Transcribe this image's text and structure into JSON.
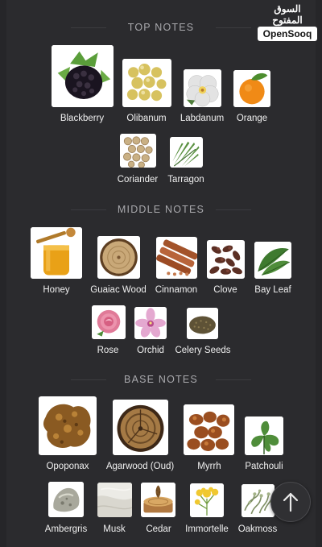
{
  "brand": {
    "arabic": "السوق المفتوح",
    "english": "OpenSooq"
  },
  "sections": [
    {
      "title": "TOP NOTES",
      "notes": [
        {
          "label": "Blackberry",
          "icon": "blackberry-icon"
        },
        {
          "label": "Olibanum",
          "icon": "olibanum-icon"
        },
        {
          "label": "Labdanum",
          "icon": "labdanum-icon"
        },
        {
          "label": "Orange",
          "icon": "orange-icon"
        },
        {
          "label": "Coriander",
          "icon": "coriander-icon"
        },
        {
          "label": "Tarragon",
          "icon": "tarragon-icon"
        }
      ]
    },
    {
      "title": "MIDDLE NOTES",
      "notes": [
        {
          "label": "Honey",
          "icon": "honey-icon"
        },
        {
          "label": "Guaiac Wood",
          "icon": "guaiac-wood-icon"
        },
        {
          "label": "Cinnamon",
          "icon": "cinnamon-icon"
        },
        {
          "label": "Clove",
          "icon": "clove-icon"
        },
        {
          "label": "Bay Leaf",
          "icon": "bay-leaf-icon"
        },
        {
          "label": "Rose",
          "icon": "rose-icon"
        },
        {
          "label": "Orchid",
          "icon": "orchid-icon"
        },
        {
          "label": "Celery Seeds",
          "icon": "celery-seeds-icon"
        }
      ]
    },
    {
      "title": "BASE NOTES",
      "notes": [
        {
          "label": "Opoponax",
          "icon": "opoponax-icon"
        },
        {
          "label": "Agarwood (Oud)",
          "icon": "agarwood-icon"
        },
        {
          "label": "Myrrh",
          "icon": "myrrh-icon"
        },
        {
          "label": "Patchouli",
          "icon": "patchouli-icon"
        },
        {
          "label": "Ambergris",
          "icon": "ambergris-icon"
        },
        {
          "label": "Musk",
          "icon": "musk-icon"
        },
        {
          "label": "Cedar",
          "icon": "cedar-icon"
        },
        {
          "label": "Immortelle",
          "icon": "immortelle-icon"
        },
        {
          "label": "Oakmoss",
          "icon": "oakmoss-icon"
        }
      ]
    }
  ],
  "scroll_top": {
    "icon": "arrow-up-icon"
  }
}
